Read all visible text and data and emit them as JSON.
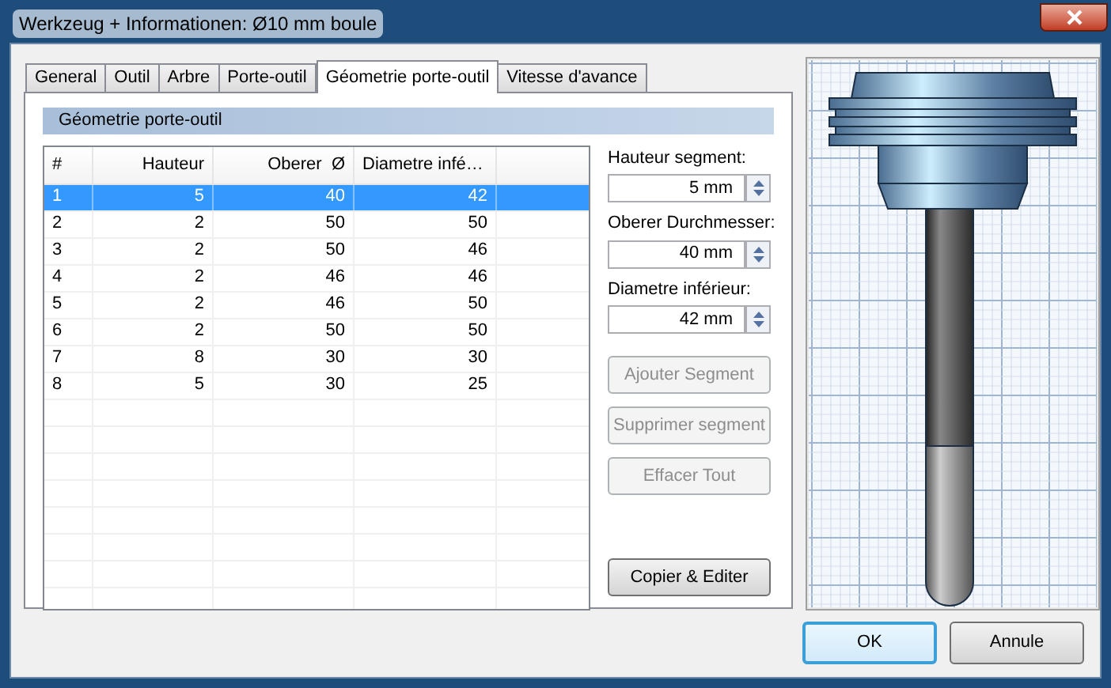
{
  "window": {
    "title": "Werkzeug + Informationen: Ø10 mm boule"
  },
  "tabs": [
    {
      "label": "General",
      "selected": false
    },
    {
      "label": "Outil",
      "selected": false
    },
    {
      "label": "Arbre",
      "selected": false
    },
    {
      "label": "Porte-outil",
      "selected": false
    },
    {
      "label": "Géometrie porte-outil",
      "selected": true
    },
    {
      "label": "Vitesse d'avance",
      "selected": false
    }
  ],
  "section_title": "Géometrie porte-outil",
  "table": {
    "columns": [
      "#",
      "Hauteur",
      "Oberer  Ø",
      "Diametre infé…"
    ],
    "rows": [
      {
        "cells": [
          "1",
          "5",
          "40",
          "42"
        ],
        "selected": true
      },
      {
        "cells": [
          "2",
          "2",
          "50",
          "50"
        ],
        "selected": false
      },
      {
        "cells": [
          "3",
          "2",
          "50",
          "46"
        ],
        "selected": false
      },
      {
        "cells": [
          "4",
          "2",
          "46",
          "46"
        ],
        "selected": false
      },
      {
        "cells": [
          "5",
          "2",
          "46",
          "50"
        ],
        "selected": false
      },
      {
        "cells": [
          "6",
          "2",
          "50",
          "50"
        ],
        "selected": false
      },
      {
        "cells": [
          "7",
          "8",
          "30",
          "30"
        ],
        "selected": false
      },
      {
        "cells": [
          "8",
          "5",
          "30",
          "25"
        ],
        "selected": false
      }
    ]
  },
  "fields": [
    {
      "label": "Hauteur segment:",
      "value": "5 mm"
    },
    {
      "label": "Oberer Durchmesser:",
      "value": "40 mm"
    },
    {
      "label": "Diametre inférieur:",
      "value": "42 mm"
    }
  ],
  "actions": [
    {
      "label": "Ajouter Segment",
      "disabled": true
    },
    {
      "label": "Supprimer segment",
      "disabled": true
    },
    {
      "label": "Effacer Tout",
      "disabled": true
    }
  ],
  "copy_button": {
    "label": "Copier & Editer",
    "disabled": false
  },
  "dialog_buttons": [
    {
      "label": "OK",
      "default": true
    },
    {
      "label": "Annule",
      "default": false
    }
  ]
}
